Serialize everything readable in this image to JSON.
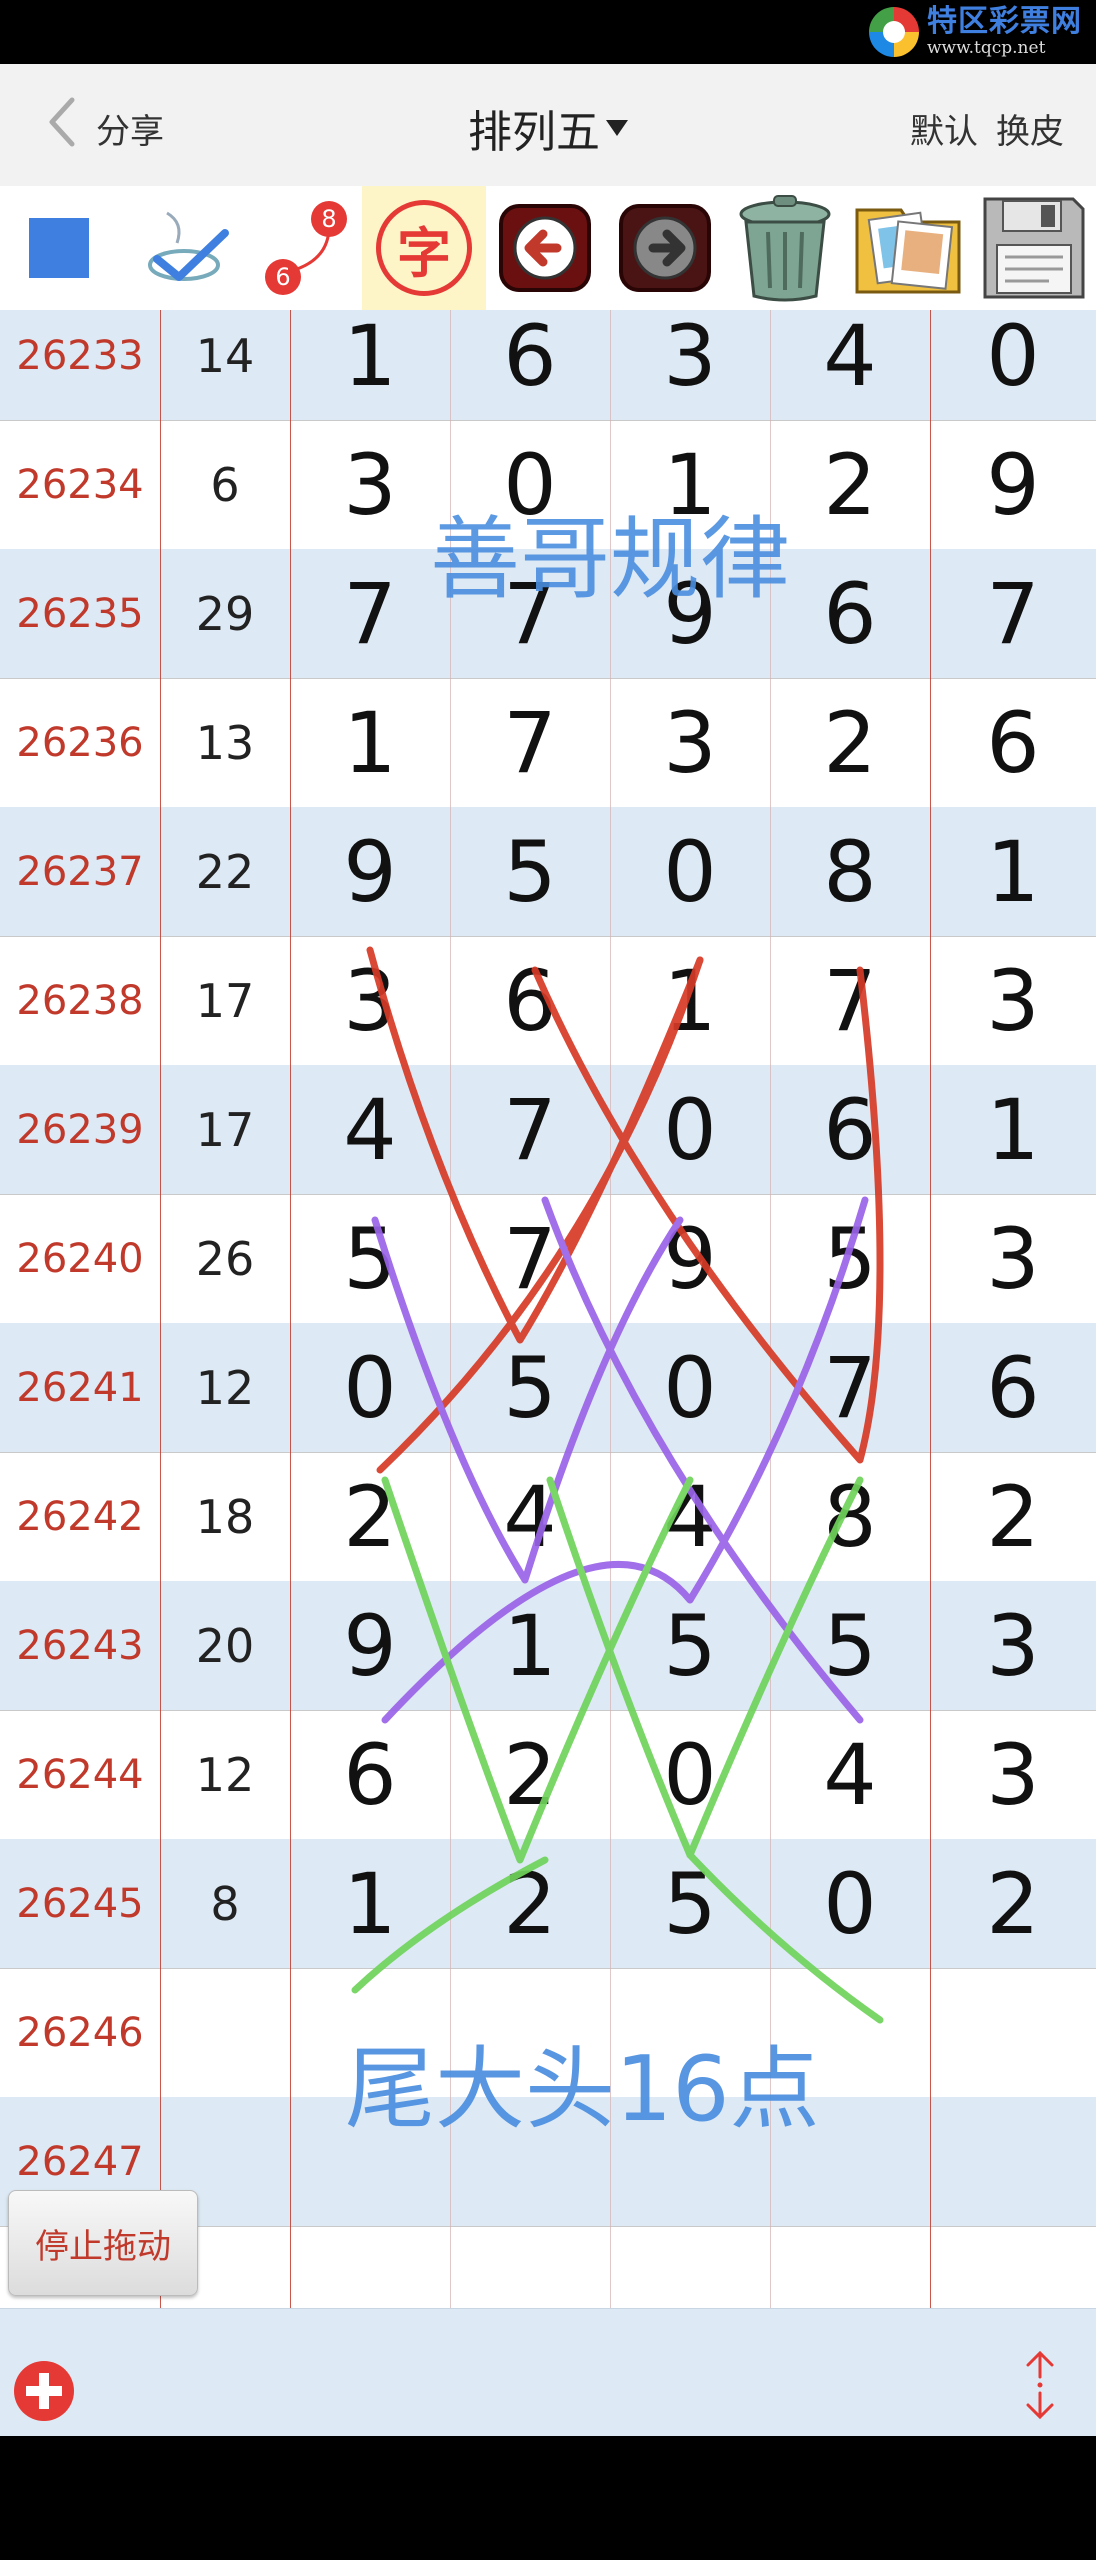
{
  "brand": {
    "name": "特区彩票网",
    "url": "www.tqcp.net"
  },
  "nav": {
    "share_label": "分享",
    "title": "排列五",
    "default_label": "默认",
    "skin_label": "换皮"
  },
  "toolbar": {
    "badge_top": "8",
    "badge_bottom": "6",
    "char_label": "字",
    "icons": [
      "color-square-icon",
      "draw-check-icon",
      "line-link-icon",
      "text-tool-icon",
      "undo-arrow-icon",
      "redo-arrow-icon",
      "trash-bin-icon",
      "photo-album-icon",
      "floppy-save-icon"
    ]
  },
  "colors": {
    "accent_red": "#c0392b",
    "row_alt": "#dde9f4",
    "annotation_blue": "#4a8ee0",
    "line_red": "#d63a26",
    "line_purple": "#9a63e8",
    "line_green": "#6fd35a"
  },
  "rows": [
    {
      "issue": "26233",
      "sum": "14",
      "d": [
        "1",
        "6",
        "3",
        "4",
        "0"
      ]
    },
    {
      "issue": "26234",
      "sum": "6",
      "d": [
        "3",
        "0",
        "1",
        "2",
        "9"
      ]
    },
    {
      "issue": "26235",
      "sum": "29",
      "d": [
        "7",
        "7",
        "9",
        "6",
        "7"
      ]
    },
    {
      "issue": "26236",
      "sum": "13",
      "d": [
        "1",
        "7",
        "3",
        "2",
        "6"
      ]
    },
    {
      "issue": "26237",
      "sum": "22",
      "d": [
        "9",
        "5",
        "0",
        "8",
        "1"
      ]
    },
    {
      "issue": "26238",
      "sum": "17",
      "d": [
        "3",
        "6",
        "1",
        "7",
        "3"
      ]
    },
    {
      "issue": "26239",
      "sum": "17",
      "d": [
        "4",
        "7",
        "0",
        "6",
        "1"
      ]
    },
    {
      "issue": "26240",
      "sum": "26",
      "d": [
        "5",
        "7",
        "9",
        "5",
        "3"
      ]
    },
    {
      "issue": "26241",
      "sum": "12",
      "d": [
        "0",
        "5",
        "0",
        "7",
        "6"
      ]
    },
    {
      "issue": "26242",
      "sum": "18",
      "d": [
        "2",
        "4",
        "4",
        "8",
        "2"
      ]
    },
    {
      "issue": "26243",
      "sum": "20",
      "d": [
        "9",
        "1",
        "5",
        "5",
        "3"
      ]
    },
    {
      "issue": "26244",
      "sum": "12",
      "d": [
        "6",
        "2",
        "0",
        "4",
        "3"
      ]
    },
    {
      "issue": "26245",
      "sum": "8",
      "d": [
        "1",
        "2",
        "5",
        "0",
        "2"
      ]
    },
    {
      "issue": "26246",
      "sum": "",
      "d": [
        "",
        "",
        "",
        "",
        ""
      ]
    },
    {
      "issue": "26247",
      "sum": "",
      "d": [
        "",
        "",
        "",
        "",
        ""
      ]
    },
    {
      "issue": "",
      "sum": "",
      "d": [
        "",
        "",
        "",
        "",
        ""
      ]
    }
  ],
  "annotations": {
    "top": "善哥规律",
    "bottom": "尾大头16点"
  },
  "stop_drag_label": "停止拖动",
  "bottom": {
    "add_icon": "plus-circle-icon",
    "resize_icon": "vertical-resize-icon"
  }
}
